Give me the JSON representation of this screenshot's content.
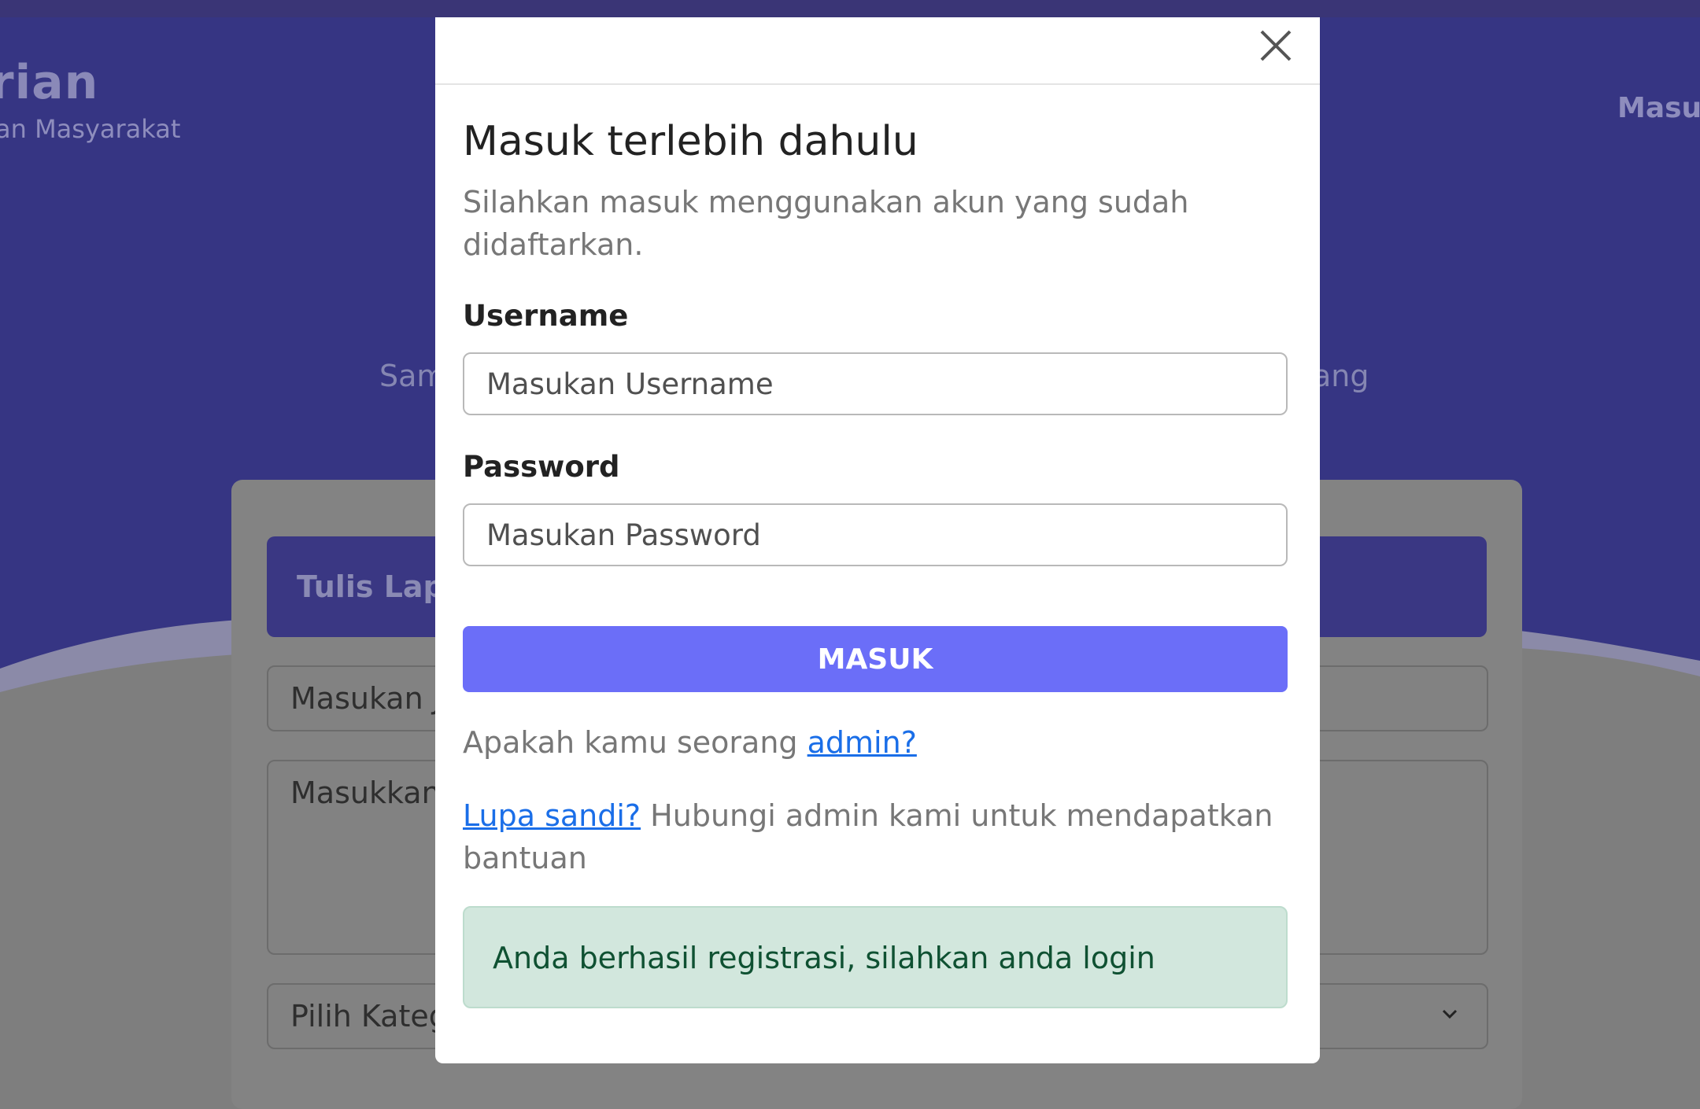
{
  "background": {
    "brand_title": "rian",
    "brand_subtitle": "an Masyarakat",
    "nav_login": "Masuk",
    "hero_text_left": "Sam",
    "hero_text_right": "ang",
    "card_header": "Tulis Lapo",
    "input_title_placeholder": "Masukan J",
    "textarea_placeholder": "Masukkan",
    "select_value": "Pilih Kateg"
  },
  "modal": {
    "title": "Masuk terlebih dahulu",
    "description": "Silahkan masuk menggunakan akun yang sudah didaftarkan.",
    "username_label": "Username",
    "username_placeholder": "Masukan Username",
    "password_label": "Password",
    "password_placeholder": "Masukan Password",
    "submit_label": "MASUK",
    "admin_prompt": "Apakah kamu seorang ",
    "admin_link": "admin?",
    "forgot_link": "Lupa sandi?",
    "forgot_text": " Hubungi admin kami untuk mendapatkan bantuan",
    "alert_text": "Anda berhasil registrasi, silahkan anda login"
  },
  "colors": {
    "primary_button": "#6b6ef8",
    "link": "#1a6ee8",
    "alert_bg": "#d2e7dd",
    "alert_text": "#0f5132",
    "hero_bg": "#363583"
  }
}
